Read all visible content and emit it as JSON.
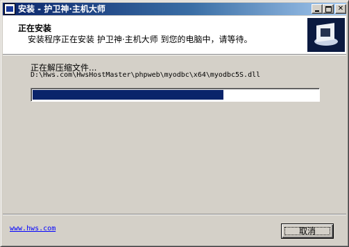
{
  "window": {
    "title": "安装 - 护卫神·主机大师"
  },
  "header": {
    "title": "正在安装",
    "description": "安装程序正在安装 护卫神·主机大师 到您的电脑中，请等待。"
  },
  "main": {
    "status": "正在解压缩文件...",
    "file_path": "D:\\Hws.com\\HwsHostMaster\\phpweb\\myodbc\\x64\\myodbc5S.dll",
    "progress": 0.67
  },
  "footer": {
    "link": "www.hws.com",
    "cancel_label": "取消"
  },
  "colors": {
    "title_bar": "#0a246a",
    "progress_fill": "#0a246a",
    "link": "#0000ff"
  },
  "icons": {
    "app": "installer-app-icon",
    "header_image": "installer-box-icon"
  }
}
